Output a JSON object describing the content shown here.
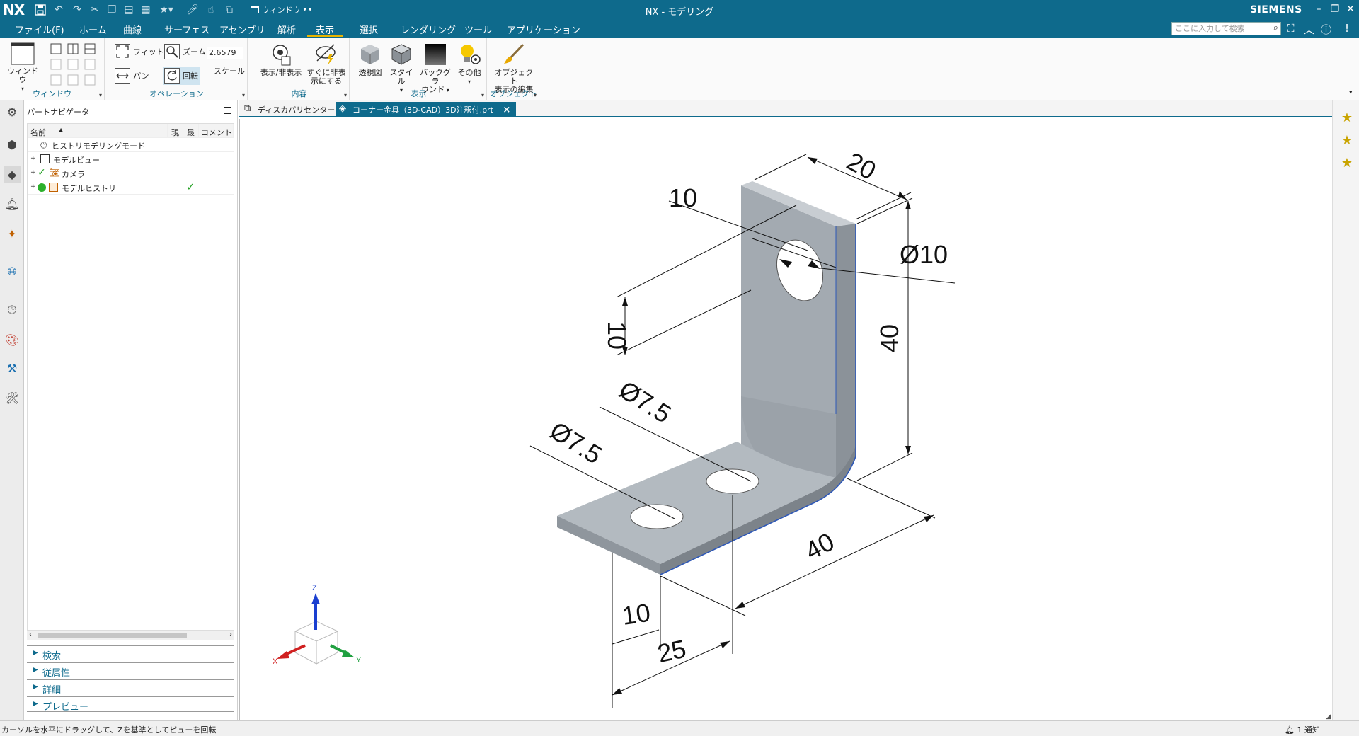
{
  "titlebar": {
    "logo": "NX",
    "title": "NX - モデリング",
    "brand": "SIEMENS",
    "window_menu": "ウィンドウ"
  },
  "menu": {
    "items": [
      "ファイル(F)",
      "ホーム",
      "曲線",
      "サーフェス",
      "アセンブリ",
      "解析",
      "表示",
      "選択",
      "レンダリング",
      "ツール",
      "アプリケーション"
    ],
    "active": "表示"
  },
  "search": {
    "placeholder": "ここに入力して検索"
  },
  "ribbon": {
    "window": {
      "btn": "ウィンドウ",
      "group": "ウィンドウ"
    },
    "operation": {
      "fit": "フィット",
      "zoom": "ズーム",
      "pan": "パン",
      "rotate": "回転",
      "scale_label": "スケール",
      "scale_value": "2.6579",
      "group": "オペレーション"
    },
    "content": {
      "show_hide": "表示/非表示",
      "instant_hide_1": "すぐに非表",
      "instant_hide_2": "示にする",
      "group": "内容"
    },
    "display": {
      "perspective": "透視図",
      "style": "スタイル",
      "background_1": "バックグラ",
      "background_2": "ウンド",
      "other": "その他",
      "group": "表示"
    },
    "object": {
      "edit_1": "オブジェクト",
      "edit_2": "表示の編集",
      "group": "オブジェクト"
    }
  },
  "navigator": {
    "title": "パートナビゲータ",
    "columns": {
      "name": "名前",
      "current": "現",
      "latest": "最",
      "comment": "コメント"
    },
    "rows": [
      {
        "label": "ヒストリモデリングモード"
      },
      {
        "label": "モデルビュー"
      },
      {
        "label": "カメラ"
      },
      {
        "label": "モデルヒストリ",
        "latest": "✓"
      }
    ],
    "panels": [
      "検索",
      "従属性",
      "詳細",
      "プレビュー"
    ]
  },
  "tabs": [
    {
      "label": "ディスカバリセンター"
    },
    {
      "label": "コーナー金具（3D-CAD）3D注釈付.prt"
    }
  ],
  "annotations": {
    "d20": "20",
    "d10_top": "10",
    "phi10": "Ø10",
    "d10_left": "10",
    "d40_right": "40",
    "phi75_a": "Ø7.5",
    "phi75_b": "Ø7.5",
    "d40_bottom": "40",
    "d10_bottom": "10",
    "d25": "25"
  },
  "triad": {
    "x": "X",
    "y": "Y",
    "z": "Z"
  },
  "statusbar": {
    "message": "カーソルを水平にドラッグして、Zを基準としてビューを回転",
    "notification": "1 通知"
  },
  "colors": {
    "accent": "#0e6a8c",
    "part": "#a9b1b8",
    "edge": "#2e58b8",
    "highlight": "#e8b400"
  }
}
